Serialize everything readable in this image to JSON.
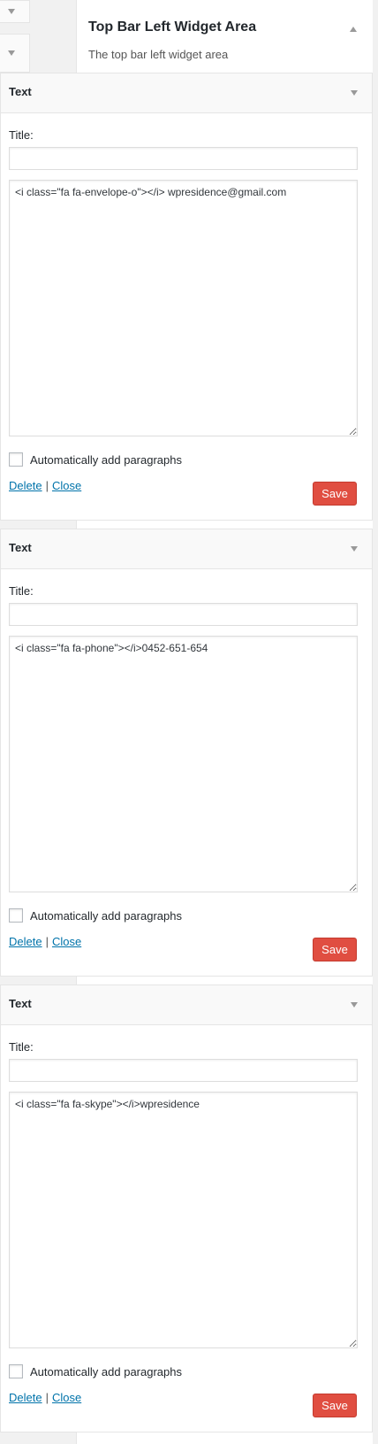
{
  "sidebar_area": {
    "title": "Top Bar Left Widget Area",
    "description": "The top bar left widget area"
  },
  "widgets": [
    {
      "name": "Text",
      "title_label": "Title:",
      "title_value": "",
      "content": "<i class=\"fa fa-envelope-o\"></i> wpresidence@gmail.com",
      "auto_paragraphs_label": "Automatically add paragraphs",
      "auto_paragraphs_checked": false,
      "delete_label": "Delete",
      "separator": "|",
      "close_label": "Close",
      "save_label": "Save"
    },
    {
      "name": "Text",
      "title_label": "Title:",
      "title_value": "",
      "content": "<i class=\"fa fa-phone\"></i>0452-651-654",
      "auto_paragraphs_label": "Automatically add paragraphs",
      "auto_paragraphs_checked": false,
      "delete_label": "Delete",
      "separator": "|",
      "close_label": "Close",
      "save_label": "Save"
    },
    {
      "name": "Text",
      "title_label": "Title:",
      "title_value": "",
      "content": "<i class=\"fa fa-skype\"></i>wpresidence",
      "auto_paragraphs_label": "Automatically add paragraphs",
      "auto_paragraphs_checked": false,
      "delete_label": "Delete",
      "separator": "|",
      "close_label": "Close",
      "save_label": "Save"
    }
  ],
  "colors": {
    "save_button": "#e04e41",
    "link": "#0073aa",
    "background": "#f1f1f1"
  }
}
